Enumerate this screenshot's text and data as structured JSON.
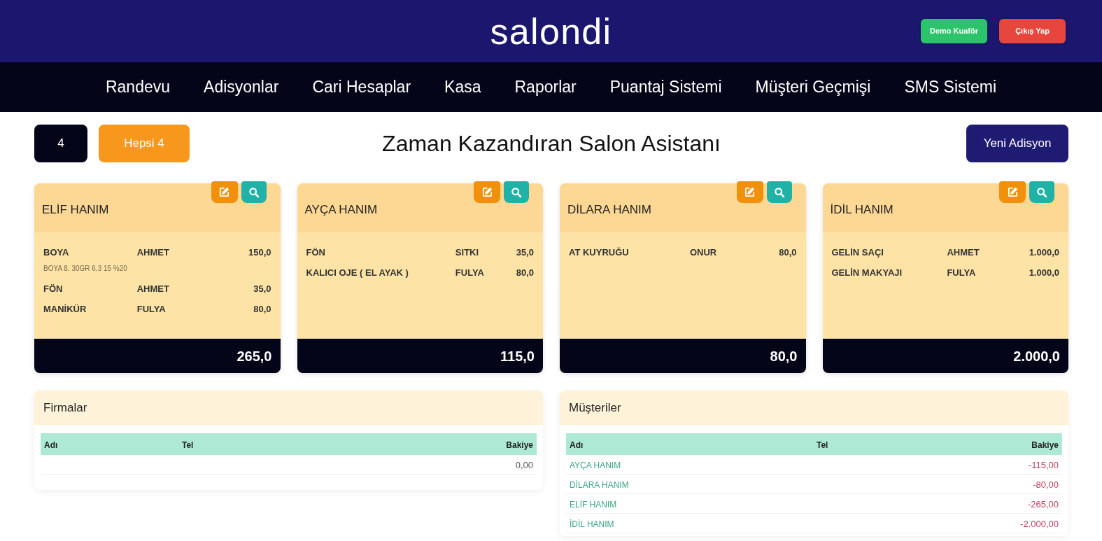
{
  "header": {
    "logo": "salondi",
    "buttons": [
      {
        "label": "Demo Kuaför",
        "kind": "account"
      },
      {
        "label": "Çıkış Yap",
        "kind": "logout"
      }
    ]
  },
  "nav": [
    {
      "label": "Randevu"
    },
    {
      "label": "Adisyonlar"
    },
    {
      "label": "Cari Hesaplar"
    },
    {
      "label": "Kasa"
    },
    {
      "label": "Raporlar"
    },
    {
      "label": "Puantaj Sistemi"
    },
    {
      "label": "Müşteri Geçmişi"
    },
    {
      "label": "SMS Sistemi"
    }
  ],
  "toolbar": {
    "count": "4",
    "filter": "Hepsi 4",
    "title": "Zaman Kazandıran Salon Asistanı",
    "new_button": "Yeni Adisyon"
  },
  "tickets": [
    {
      "customer": "ELİF HANIM",
      "items": [
        {
          "service": "BOYA",
          "staff": "AHMET",
          "price": "150,0",
          "note": "BOYA 8. 30GR 6.3 15 %20"
        },
        {
          "service": "FÖN",
          "staff": "AHMET",
          "price": "35,0"
        },
        {
          "service": "MANİKÜR",
          "staff": "FULYA",
          "price": "80,0"
        }
      ],
      "total": "265,0"
    },
    {
      "customer": "AYÇA HANIM",
      "items": [
        {
          "service": "FÖN",
          "staff": "SITKI",
          "price": "35,0"
        },
        {
          "service": "KALICI OJE ( EL AYAK )",
          "staff": "FULYA",
          "price": "80,0"
        }
      ],
      "total": "115,0"
    },
    {
      "customer": "DİLARA HANIM",
      "items": [
        {
          "service": "AT KUYRUĞU",
          "staff": "ONUR",
          "price": "80,0"
        }
      ],
      "total": "80,0"
    },
    {
      "customer": "İDİL HANIM",
      "items": [
        {
          "service": "GELİN SAÇI",
          "staff": "AHMET",
          "price": "1.000,0"
        },
        {
          "service": "GELİN MAKYAJI",
          "staff": "FULYA",
          "price": "1.000,0"
        }
      ],
      "total": "2.000,0"
    }
  ],
  "tables": [
    {
      "kind": "firms",
      "title": "Firmalar",
      "columns": [
        "Adı",
        "Tel",
        "Bakiye"
      ],
      "rows": [
        {
          "balance": "0,00"
        }
      ]
    },
    {
      "kind": "customers",
      "title": "Müşteriler",
      "columns": [
        "Adı",
        "Tel",
        "Bakiye"
      ],
      "rows": [
        {
          "name": "AYÇA HANIM",
          "balance": "-115,00"
        },
        {
          "name": "DİLARA HANIM",
          "balance": "-80,00"
        },
        {
          "name": "ELİF HANIM",
          "balance": "-265,00"
        },
        {
          "name": "İDİL HANIM",
          "balance": "-2.000,00"
        }
      ]
    }
  ]
}
